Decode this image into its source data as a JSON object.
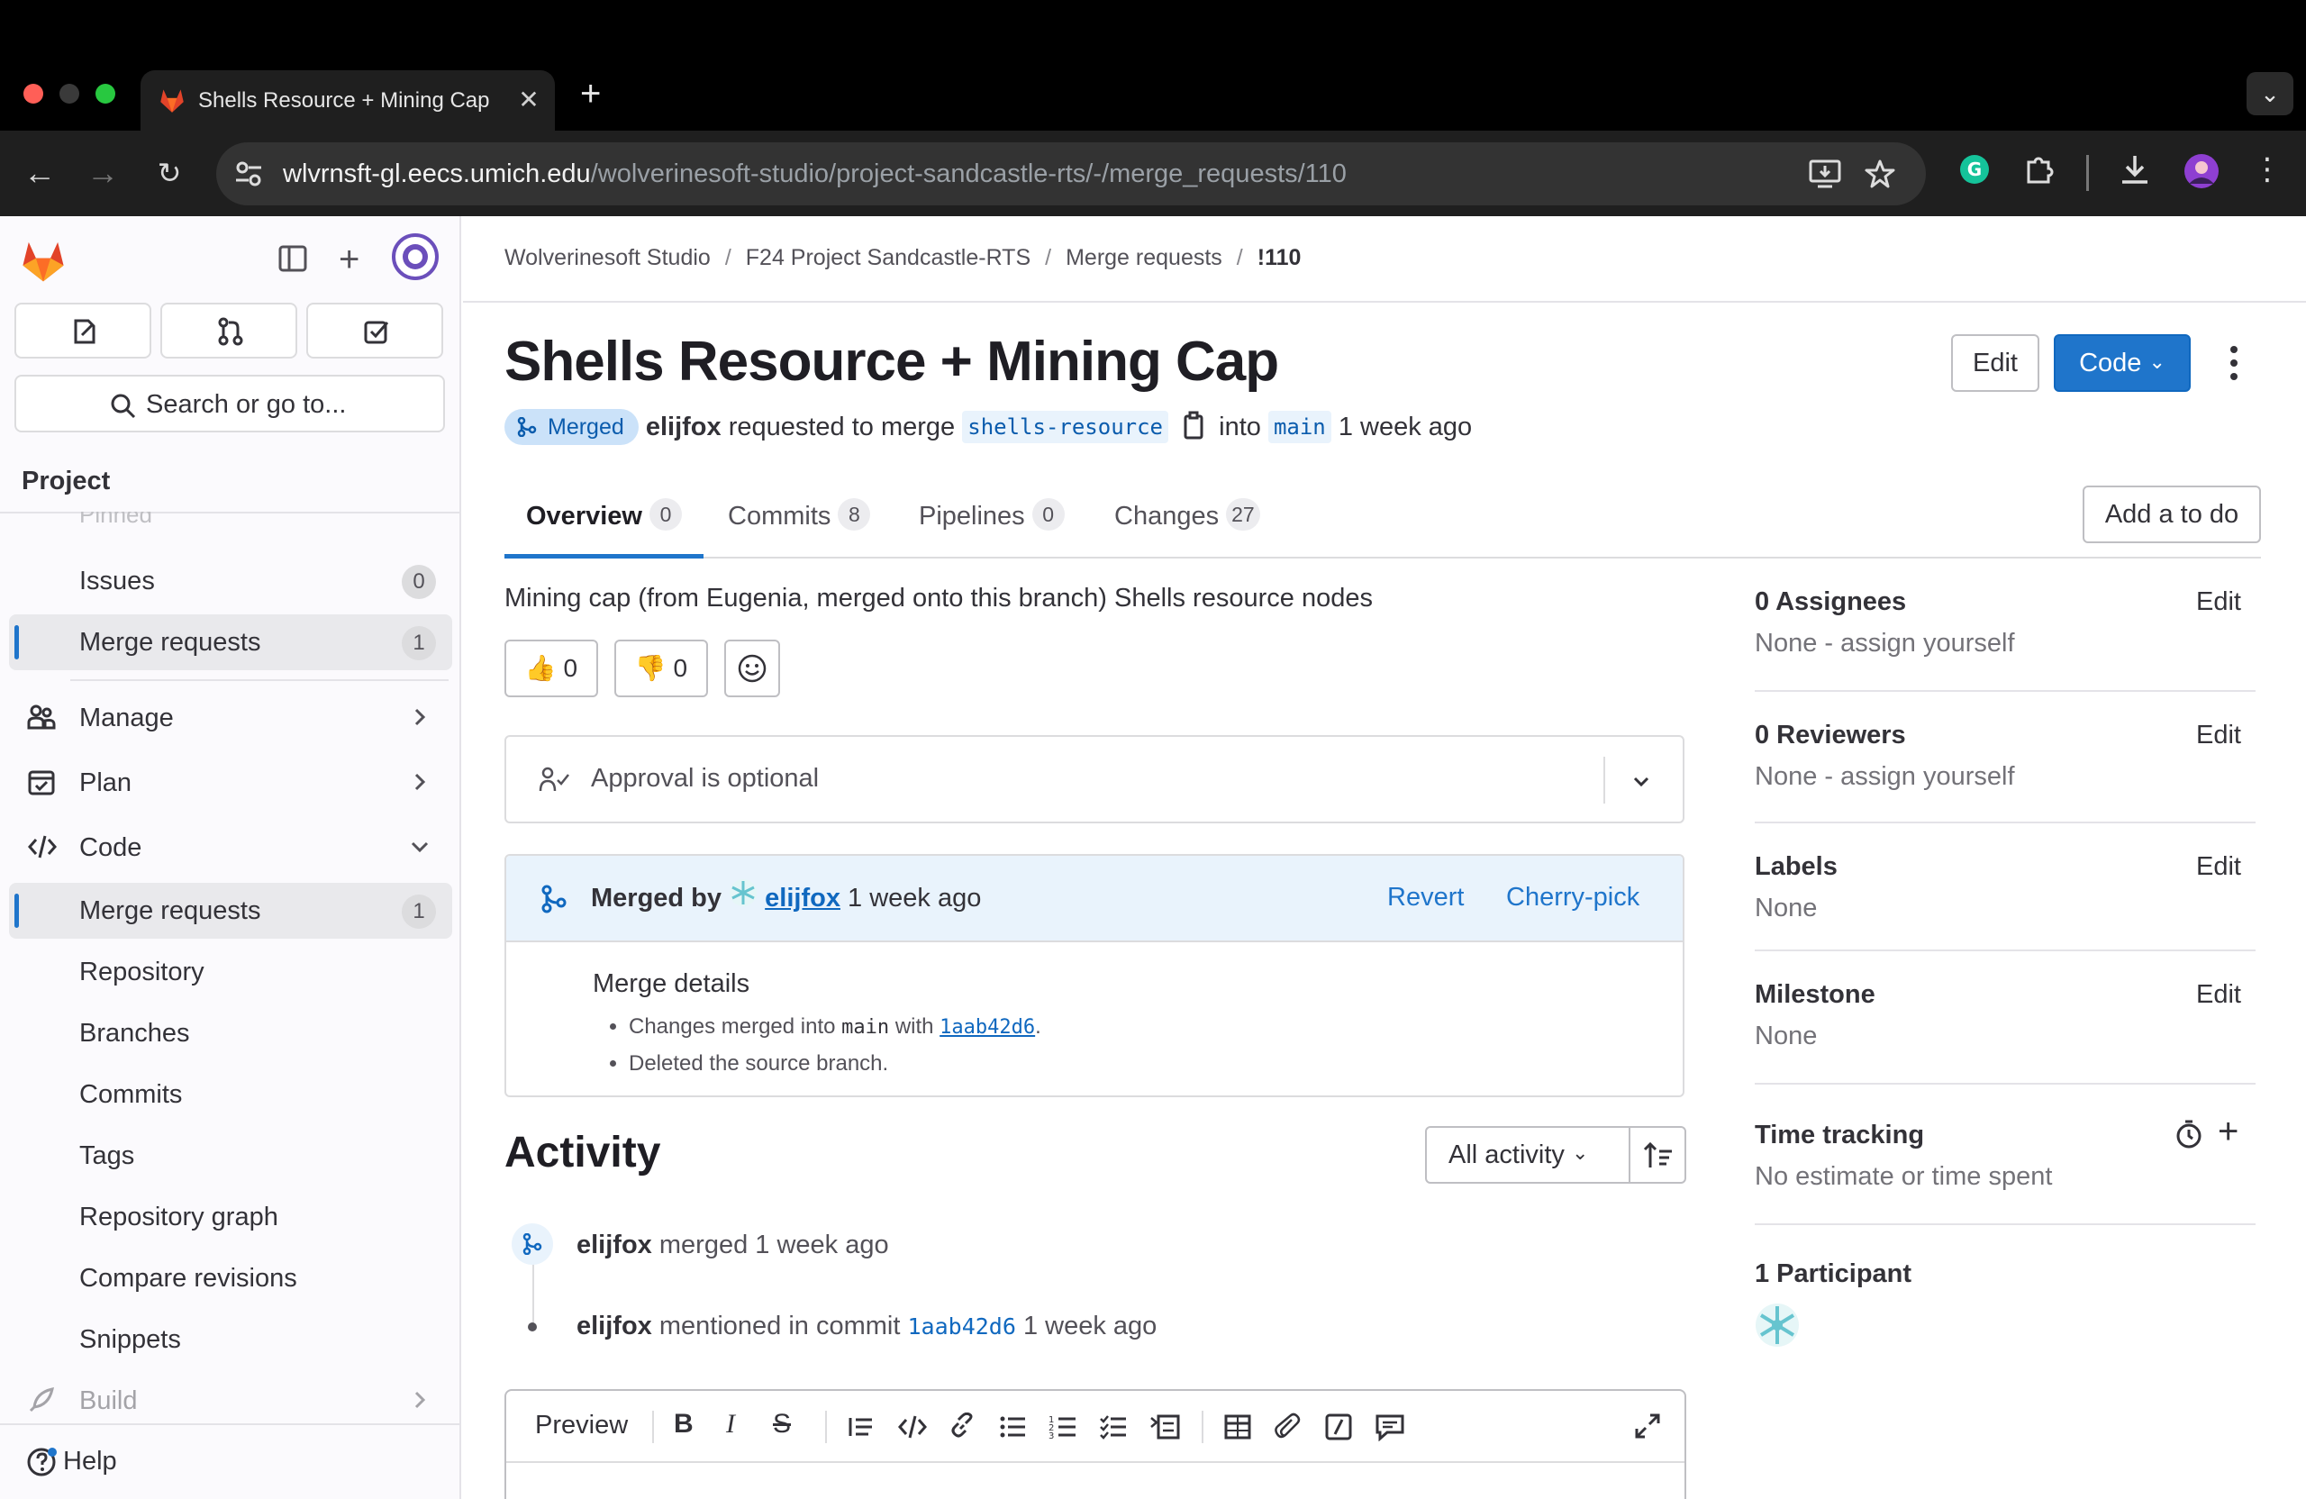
{
  "browser": {
    "tab_title": "Shells Resource + Mining Cap",
    "url_host": "wlvrnsft-gl.eecs.umich.edu",
    "url_path": "/wolverinesoft-studio/project-sandcastle-rts/-/merge_requests/110"
  },
  "sidebar": {
    "search_placeholder": "Search or go to...",
    "section_title": "Project",
    "pinned_label": "Pinned",
    "items": [
      {
        "label": "Issues",
        "badge": "0"
      },
      {
        "label": "Merge requests",
        "badge": "1"
      },
      {
        "label": "Manage"
      },
      {
        "label": "Plan"
      },
      {
        "label": "Code"
      },
      {
        "label": "Merge requests",
        "badge": "1"
      },
      {
        "label": "Repository"
      },
      {
        "label": "Branches"
      },
      {
        "label": "Commits"
      },
      {
        "label": "Tags"
      },
      {
        "label": "Repository graph"
      },
      {
        "label": "Compare revisions"
      },
      {
        "label": "Snippets"
      },
      {
        "label": "Build"
      }
    ],
    "help_label": "Help"
  },
  "breadcrumb": [
    "Wolverinesoft Studio",
    "F24 Project Sandcastle-RTS",
    "Merge requests",
    "!110"
  ],
  "mr": {
    "title": "Shells Resource + Mining Cap",
    "edit_label": "Edit",
    "code_label": "Code",
    "status": "Merged",
    "author": "elijfox",
    "requested_text": "requested to merge",
    "source_branch": "shells-resource",
    "into_text": "into",
    "target_branch": "main",
    "time": "1 week ago",
    "description": "Mining cap (from Eugenia, merged onto this branch) Shells resource nodes",
    "thumbs_up": "0",
    "thumbs_down": "0"
  },
  "tabs": [
    {
      "label": "Overview",
      "count": "0"
    },
    {
      "label": "Commits",
      "count": "8"
    },
    {
      "label": "Pipelines",
      "count": "0"
    },
    {
      "label": "Changes",
      "count": "27"
    }
  ],
  "add_todo_label": "Add a to do",
  "approval_text": "Approval is optional",
  "merged_widget": {
    "merged_by": "Merged by",
    "user": "elijfox",
    "time": "1 week ago",
    "revert": "Revert",
    "cherry_pick": "Cherry-pick",
    "details_title": "Merge details",
    "detail_1_prefix": "Changes merged into",
    "detail_1_branch": "main",
    "detail_1_with": "with",
    "detail_1_hash": "1aab42d6",
    "detail_1_suffix": ".",
    "detail_2": "Deleted the source branch."
  },
  "activity": {
    "title": "Activity",
    "filter_label": "All activity",
    "events": [
      {
        "user": "elijfox",
        "text": "merged",
        "time": "1 week ago"
      },
      {
        "user": "elijfox",
        "text": "mentioned in commit",
        "hash": "1aab42d6",
        "time": "1 week ago"
      }
    ],
    "editor_preview": "Preview"
  },
  "right_sidebar": {
    "assignees_title": "0 Assignees",
    "assignees_value": "None - assign yourself",
    "reviewers_title": "0 Reviewers",
    "reviewers_value": "None - assign yourself",
    "labels_title": "Labels",
    "labels_value": "None",
    "milestone_title": "Milestone",
    "milestone_value": "None",
    "time_title": "Time tracking",
    "time_value": "No estimate or time spent",
    "participants_title": "1 Participant",
    "edit_label": "Edit"
  },
  "colors": {
    "accent": "#1f75cb",
    "merged_badge_bg": "#cbe2f9",
    "sidebar_bg": "#fbfafd"
  }
}
